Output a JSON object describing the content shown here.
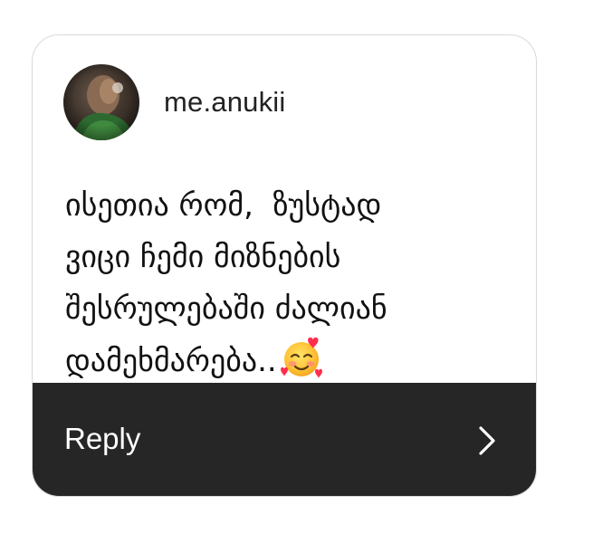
{
  "card": {
    "username": "me.anukii",
    "avatar_icon": "profile-photo",
    "message_lines": [
      "ისეთია რომ,  ზუსტად",
      "ვიცი ჩემი მიზნების",
      "შესრულებაში ძალიან",
      "დამეხმარება.."
    ],
    "message_emoji": "smiling-face-with-hearts",
    "reply_label": "Reply",
    "reply_icon": "chevron-right-icon"
  },
  "colors": {
    "card_background": "#ffffff",
    "card_border": "#d9d9d9",
    "reply_bar": "#262626",
    "reply_text": "#ffffff",
    "message_text": "#111111"
  }
}
